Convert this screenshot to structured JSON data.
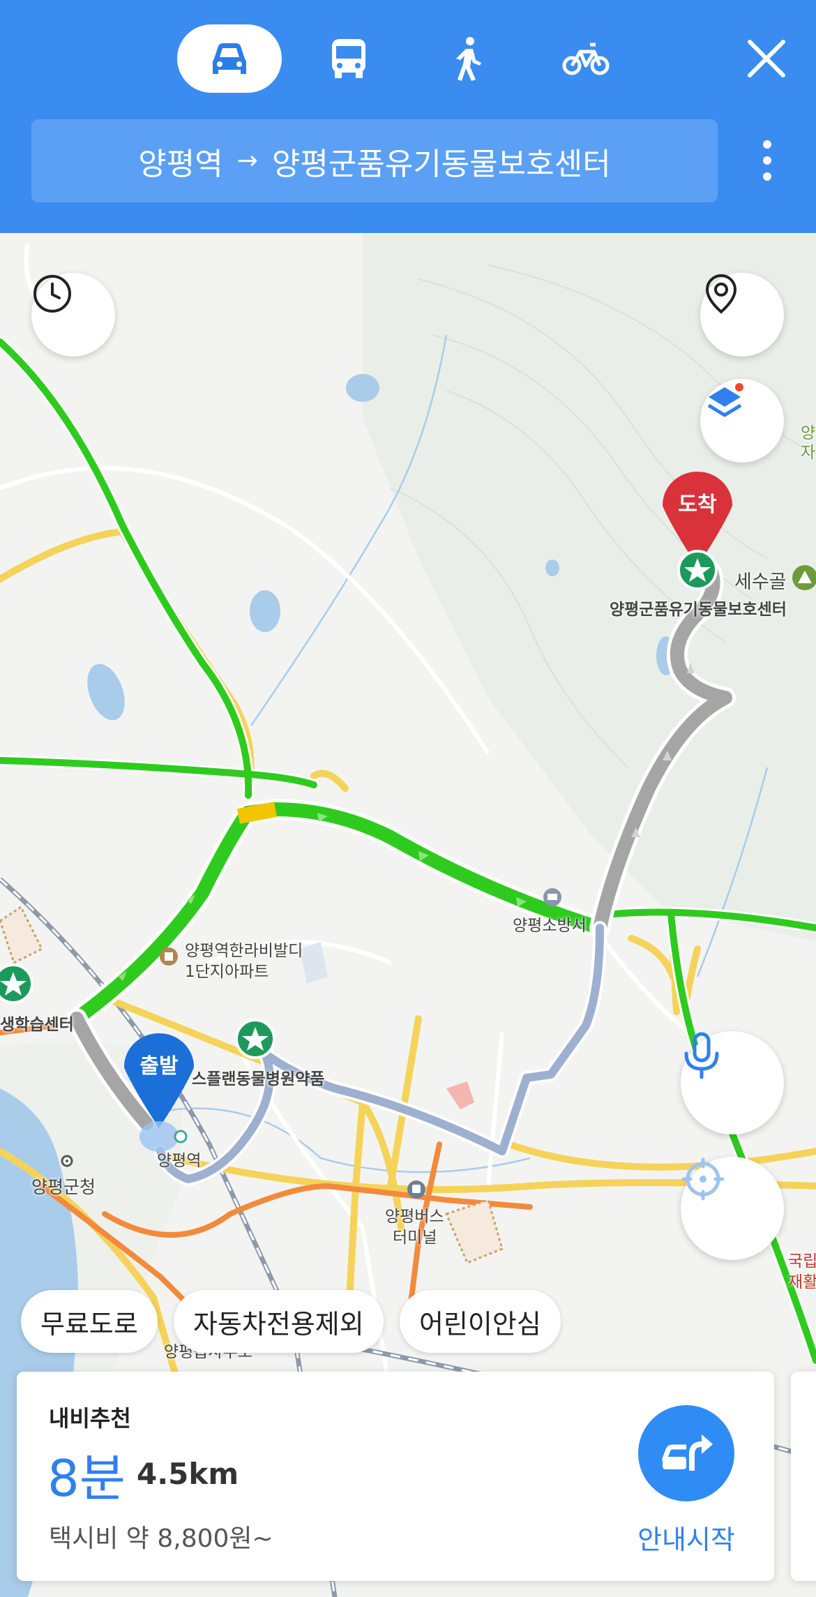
{
  "header": {
    "modes": [
      {
        "name": "car",
        "icon": "car-icon",
        "selected": true
      },
      {
        "name": "bus",
        "icon": "bus-icon",
        "selected": false
      },
      {
        "name": "walk",
        "icon": "walk-icon",
        "selected": false
      },
      {
        "name": "bike",
        "icon": "bike-icon",
        "selected": false
      }
    ],
    "close_icon": "close-icon",
    "route": {
      "origin": "양평역",
      "arrow": "→",
      "destination": "양평군품유기동물보호센터"
    },
    "more_icon": "more-vertical-icon",
    "colors": {
      "background": "#3b8cf0",
      "route_box": "#5ba0f4"
    }
  },
  "map": {
    "markers": {
      "start": "출발",
      "end": "도착"
    },
    "labels": {
      "destination_poi": "양평군품유기동물보호센터",
      "sesugol": "세수골",
      "fire_station": "양평소방서",
      "apartment_line1": "양평역한라비발디",
      "apartment_line2": "1단지아파트",
      "learning_center": "생학습센터",
      "animal_hospital": "스플랜동물병원약품",
      "station": "양평역",
      "county_office": "양평군청",
      "bus_terminal_line1": "양평버스",
      "bus_terminal_line2": "터미널",
      "bottom_area": "양평읍사무소",
      "right_edge1_line1": "양",
      "right_edge1_line2": "자",
      "right_edge2_line1": "국립",
      "right_edge2_line2": "재활"
    },
    "buttons": {
      "history": "clock-icon",
      "street_view": "street-view-icon",
      "layers": "layers-icon",
      "voice": "microphone-icon",
      "locate": "crosshair-icon"
    },
    "colors": {
      "traffic_good": "#2ecb1e",
      "traffic_slow": "#f2c500",
      "route_gray": "#a5a5a5",
      "route_alt": "#9db0cf",
      "start_marker": "#1a6fd8",
      "end_marker": "#d9323a"
    }
  },
  "filters": {
    "chips": [
      "무료도로",
      "자동차전용제외",
      "어린이안심"
    ]
  },
  "result_card": {
    "recommendation": "내비추천",
    "time": "8분",
    "distance": "4.5km",
    "fare": "택시비 약 8,800원~",
    "start_label": "안내시작",
    "start_icon": "navigation-turn-icon"
  }
}
